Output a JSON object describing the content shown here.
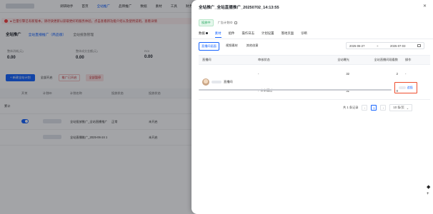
{
  "background": {
    "nav_items": [
      "调研助手",
      "首页",
      "全站推广",
      "品牌推广",
      "数据",
      "素材",
      "工具",
      "财务",
      "直播间"
    ],
    "notice": "● 巨量引擎已有新版本，请尽快更新以获取更好的服务体验，点击查看新功能介绍以及使用说明，查看详情",
    "tabs": {
      "title": "全站推广",
      "sub1": "全站直播推广（商品版）",
      "sub2": "全站投放管理"
    },
    "stats": [
      {
        "label": "整体消耗(元)",
        "value": "0.00"
      },
      {
        "label": "整体成交金额(元)",
        "value": "0.00"
      },
      {
        "label": "ROI",
        "value": "0.00"
      }
    ],
    "actions": {
      "new": "+ 新建全站计划",
      "clone": "全部开启",
      "warn": "推广已开启",
      "pause": "全部暂停"
    },
    "table": {
      "headers": [
        "开关",
        "计划ID",
        "计划名称",
        "投放状态",
        "投放状态"
      ],
      "total_label": "累计",
      "rows": [
        {
          "id_label": "",
          "name": "全站投放推广_全站直播推广_202...",
          "status": "正常",
          "extra": "未开启"
        },
        {
          "id_label": "",
          "name": "全站直播推广_2025-06-24 1...",
          "status": "",
          "extra": "未开启"
        }
      ]
    }
  },
  "drawer": {
    "title": "全站推广_全站直播推广_20250702_14:13:55",
    "status_tag": "投放中",
    "meta_id": "广告计划ID",
    "tabs": [
      "数据",
      "素材",
      "组件",
      "操作日志",
      "计划设置",
      "落地页面",
      "诊断"
    ],
    "active_tab": "素材",
    "subtabs": [
      "直播间画面",
      "视频素材",
      "其他创意"
    ],
    "date_start": "2025-06-27",
    "date_sep": "~",
    "date_end": "2025-07-03",
    "table": {
      "headers": [
        "直播间",
        "审核状态",
        "全站曝光",
        "全站直播间观看数",
        "操作"
      ],
      "rows": [
        {
          "status": "-",
          "exposure": "32",
          "views": "2",
          "op": "-"
        },
        {
          "status": "未审通过",
          "exposure": "31",
          "views": "0",
          "op": "追投"
        }
      ],
      "streamer_suffix": "直播间"
    },
    "pager": {
      "total": "共 1 条记录",
      "page": "1",
      "size": "10 条/页"
    }
  }
}
